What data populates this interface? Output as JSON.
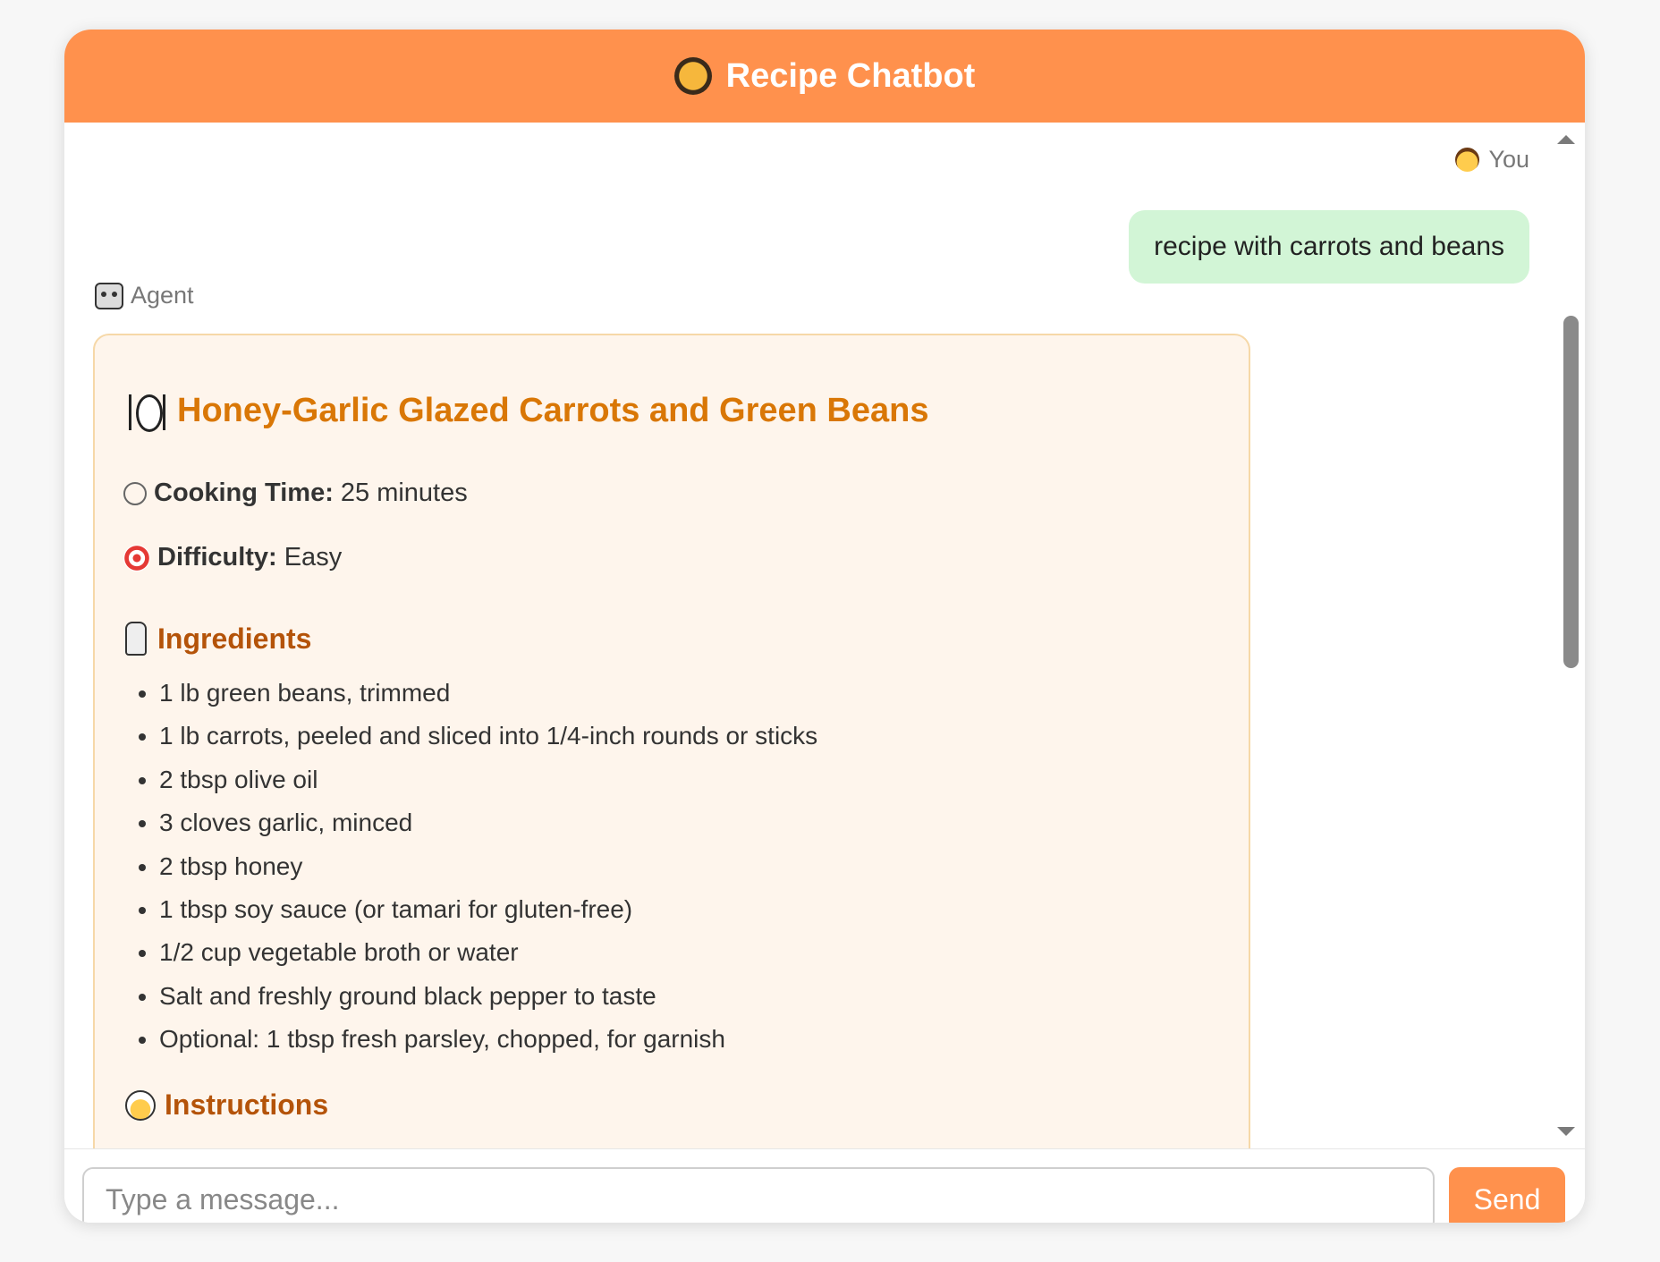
{
  "header": {
    "title": "Recipe Chatbot",
    "icon": "paella-pan-icon"
  },
  "conversation": {
    "user_message": {
      "sender_label": "You",
      "text": "recipe with carrots and beans"
    },
    "agent_message": {
      "sender_label": "Agent",
      "recipe": {
        "title": "Honey-Garlic Glazed Carrots and Green Beans",
        "cooking_time_label": "Cooking Time:",
        "cooking_time_value": "25 minutes",
        "difficulty_label": "Difficulty:",
        "difficulty_value": "Easy",
        "ingredients_heading": "Ingredients",
        "ingredients": [
          "1 lb green beans, trimmed",
          "1 lb carrots, peeled and sliced into 1/4-inch rounds or sticks",
          "2 tbsp olive oil",
          "3 cloves garlic, minced",
          "2 tbsp honey",
          "1 tbsp soy sauce (or tamari for gluten-free)",
          "1/2 cup vegetable broth or water",
          "Salt and freshly ground black pepper to taste",
          "Optional: 1 tbsp fresh parsley, chopped, for garnish"
        ],
        "instructions_heading": "Instructions"
      }
    }
  },
  "composer": {
    "placeholder": "Type a message...",
    "send_label": "Send"
  },
  "colors": {
    "accent": "#ff914d",
    "user_bubble": "#d2f5d6",
    "card_background": "#fef5ec",
    "title_color": "#d97706"
  }
}
